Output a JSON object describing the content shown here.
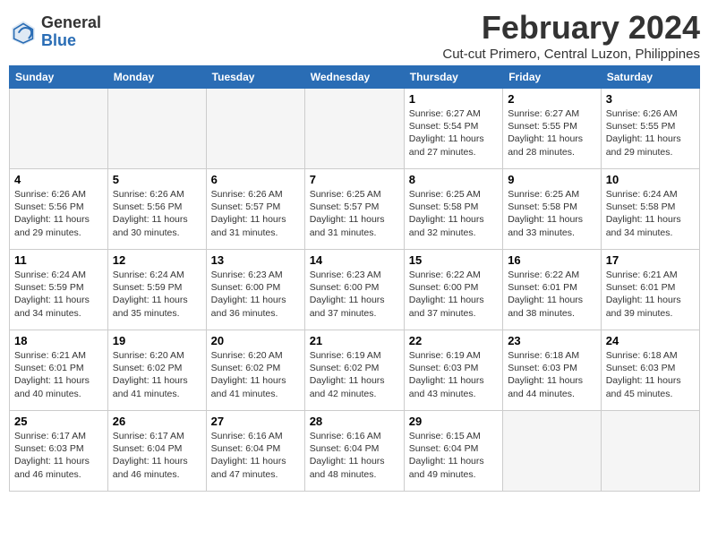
{
  "header": {
    "logo_general": "General",
    "logo_blue": "Blue",
    "month_year": "February 2024",
    "location": "Cut-cut Primero, Central Luzon, Philippines"
  },
  "weekdays": [
    "Sunday",
    "Monday",
    "Tuesday",
    "Wednesday",
    "Thursday",
    "Friday",
    "Saturday"
  ],
  "weeks": [
    [
      {
        "num": "",
        "info": ""
      },
      {
        "num": "",
        "info": ""
      },
      {
        "num": "",
        "info": ""
      },
      {
        "num": "",
        "info": ""
      },
      {
        "num": "1",
        "info": "Sunrise: 6:27 AM\nSunset: 5:54 PM\nDaylight: 11 hours\nand 27 minutes."
      },
      {
        "num": "2",
        "info": "Sunrise: 6:27 AM\nSunset: 5:55 PM\nDaylight: 11 hours\nand 28 minutes."
      },
      {
        "num": "3",
        "info": "Sunrise: 6:26 AM\nSunset: 5:55 PM\nDaylight: 11 hours\nand 29 minutes."
      }
    ],
    [
      {
        "num": "4",
        "info": "Sunrise: 6:26 AM\nSunset: 5:56 PM\nDaylight: 11 hours\nand 29 minutes."
      },
      {
        "num": "5",
        "info": "Sunrise: 6:26 AM\nSunset: 5:56 PM\nDaylight: 11 hours\nand 30 minutes."
      },
      {
        "num": "6",
        "info": "Sunrise: 6:26 AM\nSunset: 5:57 PM\nDaylight: 11 hours\nand 31 minutes."
      },
      {
        "num": "7",
        "info": "Sunrise: 6:25 AM\nSunset: 5:57 PM\nDaylight: 11 hours\nand 31 minutes."
      },
      {
        "num": "8",
        "info": "Sunrise: 6:25 AM\nSunset: 5:58 PM\nDaylight: 11 hours\nand 32 minutes."
      },
      {
        "num": "9",
        "info": "Sunrise: 6:25 AM\nSunset: 5:58 PM\nDaylight: 11 hours\nand 33 minutes."
      },
      {
        "num": "10",
        "info": "Sunrise: 6:24 AM\nSunset: 5:58 PM\nDaylight: 11 hours\nand 34 minutes."
      }
    ],
    [
      {
        "num": "11",
        "info": "Sunrise: 6:24 AM\nSunset: 5:59 PM\nDaylight: 11 hours\nand 34 minutes."
      },
      {
        "num": "12",
        "info": "Sunrise: 6:24 AM\nSunset: 5:59 PM\nDaylight: 11 hours\nand 35 minutes."
      },
      {
        "num": "13",
        "info": "Sunrise: 6:23 AM\nSunset: 6:00 PM\nDaylight: 11 hours\nand 36 minutes."
      },
      {
        "num": "14",
        "info": "Sunrise: 6:23 AM\nSunset: 6:00 PM\nDaylight: 11 hours\nand 37 minutes."
      },
      {
        "num": "15",
        "info": "Sunrise: 6:22 AM\nSunset: 6:00 PM\nDaylight: 11 hours\nand 37 minutes."
      },
      {
        "num": "16",
        "info": "Sunrise: 6:22 AM\nSunset: 6:01 PM\nDaylight: 11 hours\nand 38 minutes."
      },
      {
        "num": "17",
        "info": "Sunrise: 6:21 AM\nSunset: 6:01 PM\nDaylight: 11 hours\nand 39 minutes."
      }
    ],
    [
      {
        "num": "18",
        "info": "Sunrise: 6:21 AM\nSunset: 6:01 PM\nDaylight: 11 hours\nand 40 minutes."
      },
      {
        "num": "19",
        "info": "Sunrise: 6:20 AM\nSunset: 6:02 PM\nDaylight: 11 hours\nand 41 minutes."
      },
      {
        "num": "20",
        "info": "Sunrise: 6:20 AM\nSunset: 6:02 PM\nDaylight: 11 hours\nand 41 minutes."
      },
      {
        "num": "21",
        "info": "Sunrise: 6:19 AM\nSunset: 6:02 PM\nDaylight: 11 hours\nand 42 minutes."
      },
      {
        "num": "22",
        "info": "Sunrise: 6:19 AM\nSunset: 6:03 PM\nDaylight: 11 hours\nand 43 minutes."
      },
      {
        "num": "23",
        "info": "Sunrise: 6:18 AM\nSunset: 6:03 PM\nDaylight: 11 hours\nand 44 minutes."
      },
      {
        "num": "24",
        "info": "Sunrise: 6:18 AM\nSunset: 6:03 PM\nDaylight: 11 hours\nand 45 minutes."
      }
    ],
    [
      {
        "num": "25",
        "info": "Sunrise: 6:17 AM\nSunset: 6:03 PM\nDaylight: 11 hours\nand 46 minutes."
      },
      {
        "num": "26",
        "info": "Sunrise: 6:17 AM\nSunset: 6:04 PM\nDaylight: 11 hours\nand 46 minutes."
      },
      {
        "num": "27",
        "info": "Sunrise: 6:16 AM\nSunset: 6:04 PM\nDaylight: 11 hours\nand 47 minutes."
      },
      {
        "num": "28",
        "info": "Sunrise: 6:16 AM\nSunset: 6:04 PM\nDaylight: 11 hours\nand 48 minutes."
      },
      {
        "num": "29",
        "info": "Sunrise: 6:15 AM\nSunset: 6:04 PM\nDaylight: 11 hours\nand 49 minutes."
      },
      {
        "num": "",
        "info": ""
      },
      {
        "num": "",
        "info": ""
      }
    ]
  ]
}
